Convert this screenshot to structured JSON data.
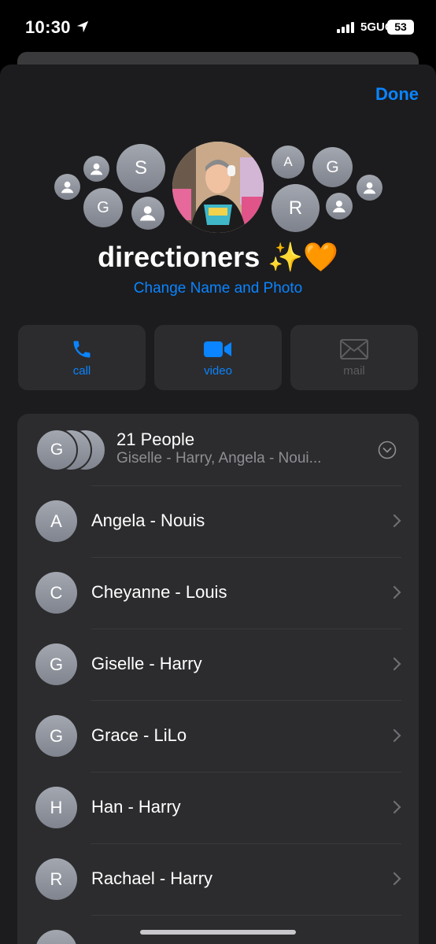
{
  "status": {
    "time": "10:30",
    "network": "5GUC",
    "battery": "53"
  },
  "header": {
    "done_label": "Done"
  },
  "group": {
    "name": "directioners ✨🧡",
    "change_label": "Change Name and Photo",
    "cluster": [
      {
        "letter": "",
        "kind": "person"
      },
      {
        "letter": "",
        "kind": "person"
      },
      {
        "letter": "S",
        "kind": "letter"
      },
      {
        "letter": "G",
        "kind": "letter"
      },
      {
        "letter": "",
        "kind": "person"
      },
      {
        "letter": "A",
        "kind": "letter"
      },
      {
        "letter": "G",
        "kind": "letter"
      },
      {
        "letter": "R",
        "kind": "letter"
      },
      {
        "letter": "",
        "kind": "person"
      },
      {
        "letter": "",
        "kind": "person"
      }
    ]
  },
  "actions": [
    {
      "label": "call",
      "icon": "phone-icon",
      "enabled": true
    },
    {
      "label": "video",
      "icon": "video-camera-icon",
      "enabled": true
    },
    {
      "label": "mail",
      "icon": "envelope-icon",
      "enabled": false
    }
  ],
  "members_summary": {
    "avatar_letter": "G",
    "title": "21 People",
    "subtitle": "Giselle - Harry, Angela - Noui..."
  },
  "members": [
    {
      "initial": "A",
      "name": "Angela - Nouis"
    },
    {
      "initial": "C",
      "name": "Cheyanne - Louis"
    },
    {
      "initial": "G",
      "name": "Giselle - Harry"
    },
    {
      "initial": "G",
      "name": "Grace - LiLo"
    },
    {
      "initial": "H",
      "name": "Han - Harry"
    },
    {
      "initial": "R",
      "name": "Rachael - Harry"
    }
  ],
  "colors": {
    "accent": "#0a84ff",
    "sheet": "#1c1c1e",
    "card": "#2c2c2e"
  }
}
